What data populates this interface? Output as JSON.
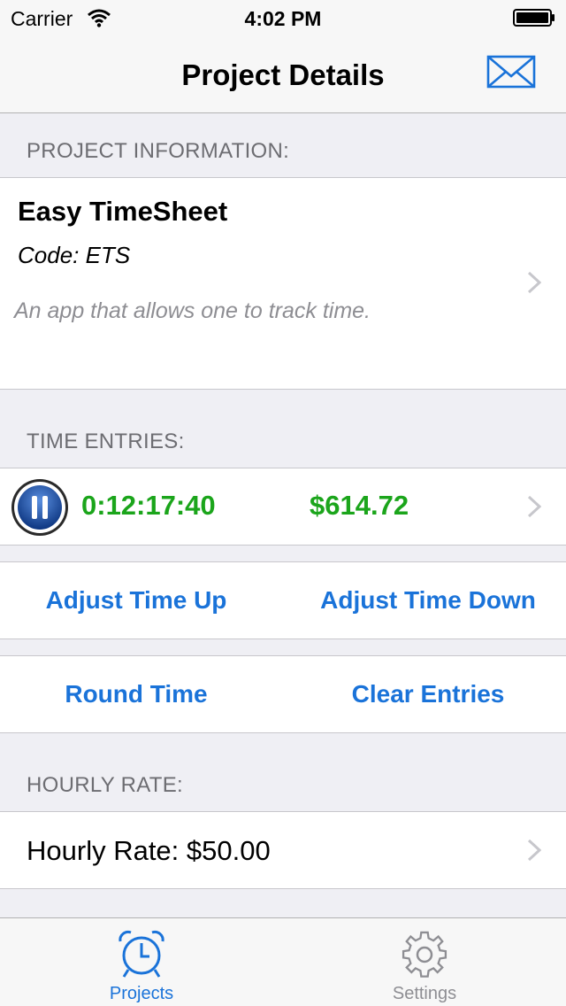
{
  "status_bar": {
    "carrier": "Carrier",
    "time": "4:02 PM"
  },
  "nav": {
    "title": "Project Details",
    "mail_icon": "mail-icon"
  },
  "project_section": {
    "header": "PROJECT INFORMATION:",
    "name": "Easy TimeSheet",
    "code": "Code: ETS",
    "description": "An app that allows one to track time."
  },
  "time_section": {
    "header": "TIME ENTRIES:",
    "elapsed": "0:12:17:40",
    "amount": "$614.72"
  },
  "actions": {
    "adjust_up": "Adjust Time Up",
    "adjust_down": "Adjust Time Down",
    "round_time": "Round Time",
    "clear_entries": "Clear Entries"
  },
  "rate_section": {
    "header": "HOURLY RATE:",
    "rate": "Hourly Rate: $50.00"
  },
  "tabs": [
    {
      "label": "Projects",
      "icon": "alarm-clock-icon",
      "active": true
    },
    {
      "label": "Settings",
      "icon": "gear-icon",
      "active": false
    }
  ],
  "colors": {
    "accent": "#1a73d9",
    "positive": "#1ba51b",
    "inactive": "#8e8e93"
  }
}
